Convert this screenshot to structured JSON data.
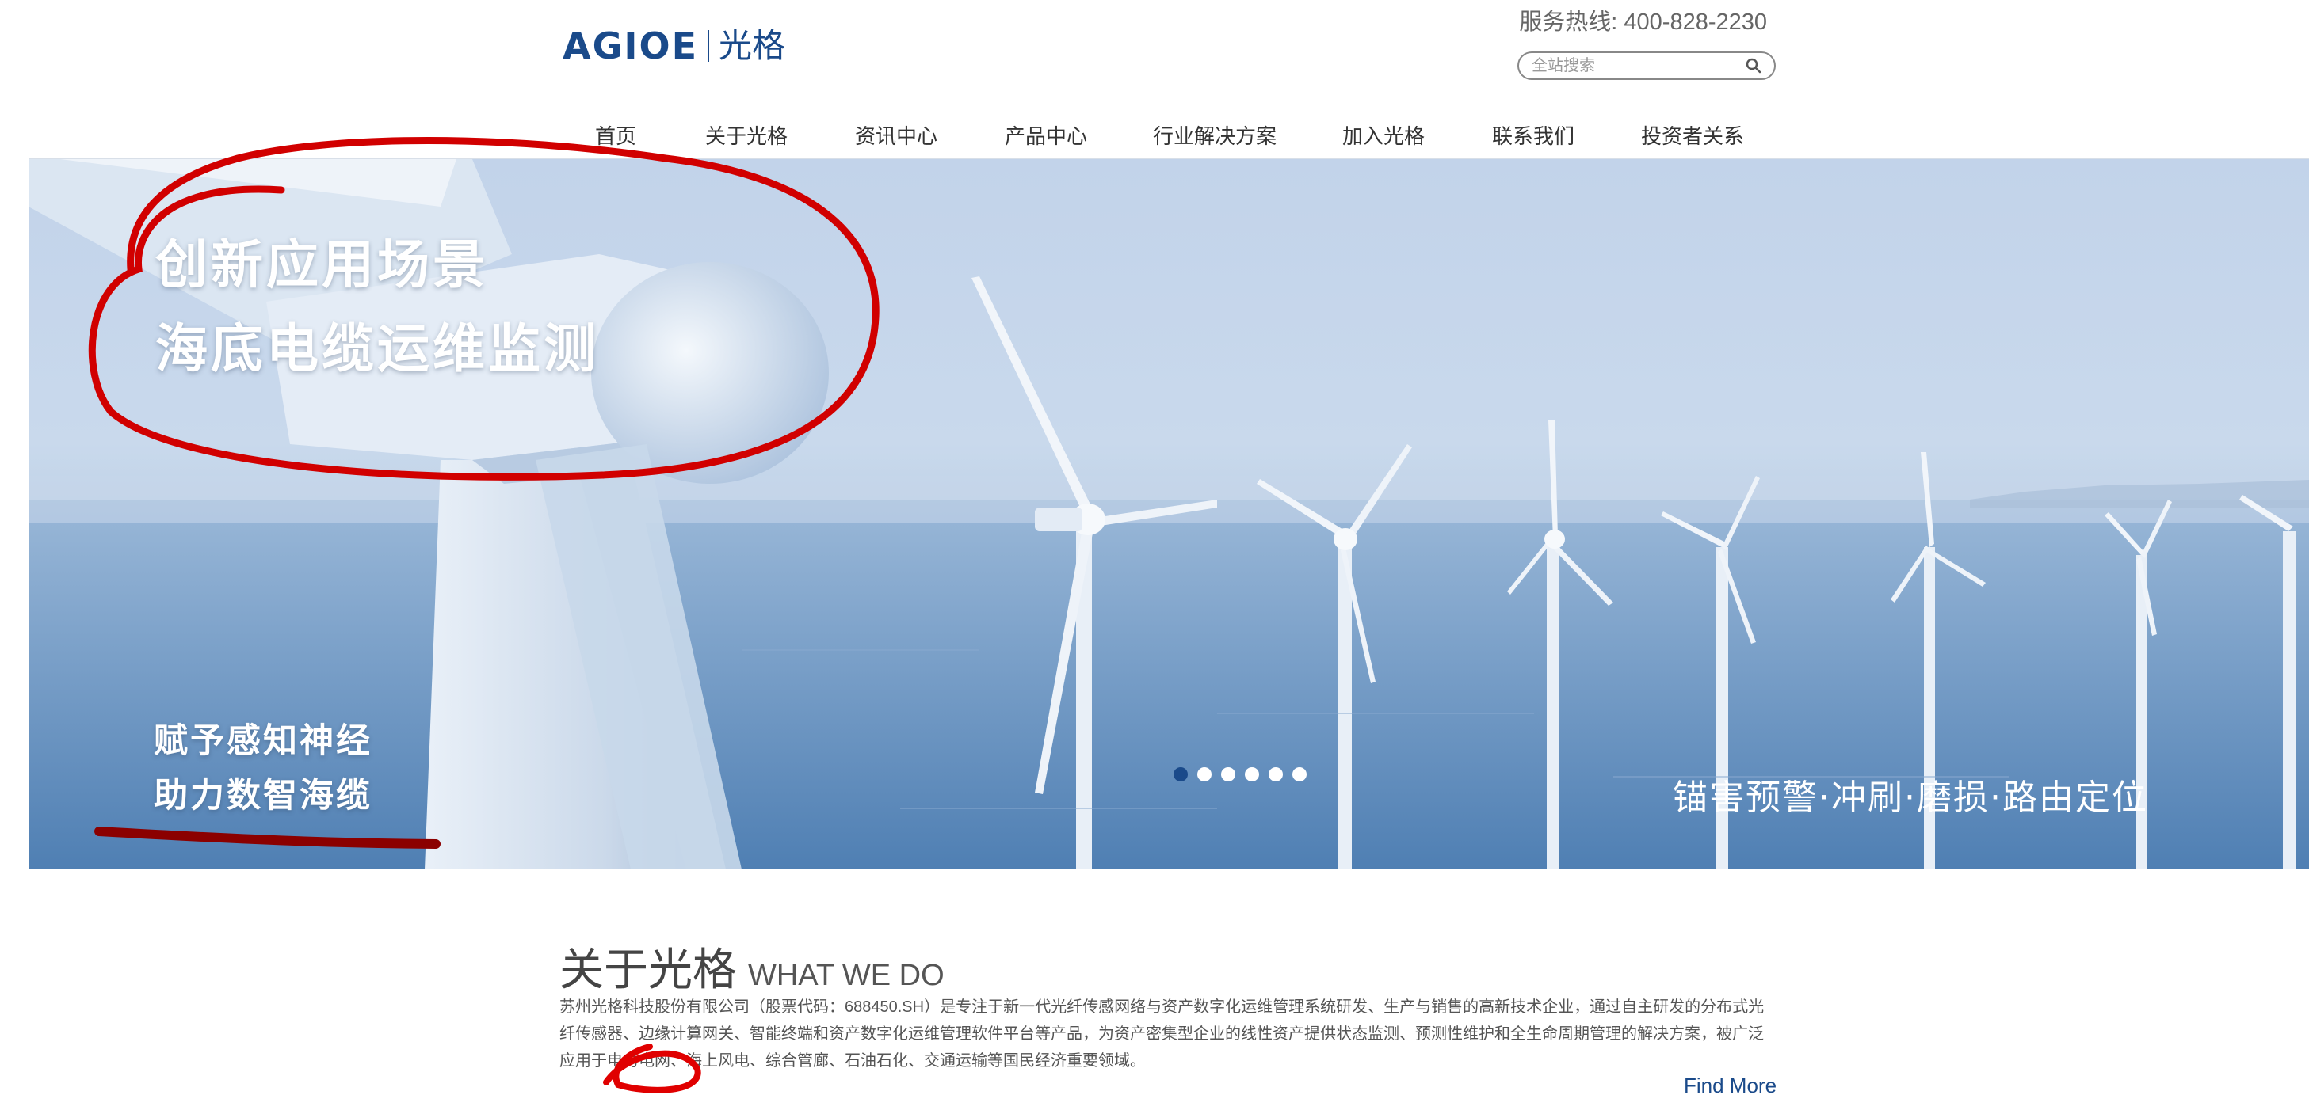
{
  "header": {
    "logo_en": "AGIOE",
    "logo_cn": "光格",
    "hotline": "服务热线: 400-828-2230",
    "search_placeholder": "全站搜索"
  },
  "nav": {
    "items": [
      {
        "label": "首页"
      },
      {
        "label": "关于光格"
      },
      {
        "label": "资讯中心"
      },
      {
        "label": "产品中心"
      },
      {
        "label": "行业解决方案"
      },
      {
        "label": "加入光格"
      },
      {
        "label": "联系我们"
      },
      {
        "label": "投资者关系"
      }
    ]
  },
  "banner": {
    "headline_line1": "创新应用场景",
    "headline_line2": "海底电缆运维监测",
    "sub_line1": "赋予感知神经",
    "sub_line2": "助力数智海缆",
    "tagline": "锚害预警·冲刷·磨损·路由定位",
    "slide_count": 6,
    "active_slide": 1
  },
  "about": {
    "title_cn": "关于光格",
    "title_en": "WHAT WE DO",
    "body": "苏州光格科技股份有限公司（股票代码：688450.SH）是专注于新一代光纤传感网络与资产数字化运维管理系统研发、生产与销售的高新技术企业，通过自主研发的分布式光纤传感器、边缘计算网关、智能终端和资产数字化运维管理软件平台等产品，为资产密集型企业的线性资产提供状态监测、预测性维护和全生命周期管理的解决方案，被广泛应用于电力电网、海上风电、综合管廊、石油石化、交通运输等国民经济重要领域。",
    "find_more": "Find More"
  },
  "colors": {
    "brand": "#1a4a8a",
    "annotation_red": "#d10000",
    "annotation_dark_red": "#8b0000"
  }
}
